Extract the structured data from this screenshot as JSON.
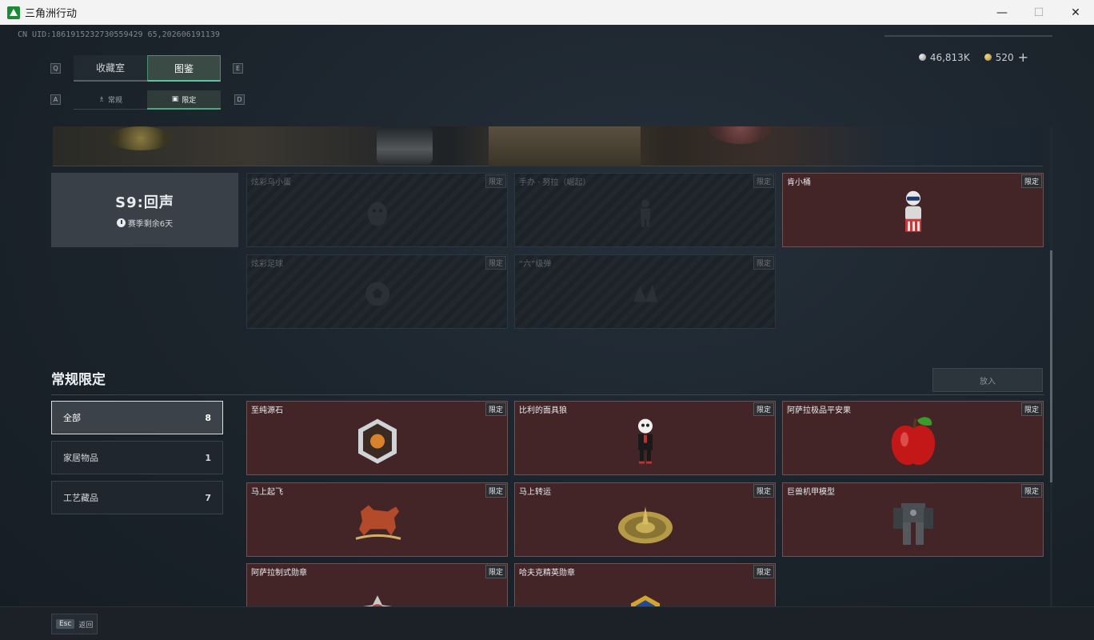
{
  "window": {
    "title": "三角洲行动",
    "minimize": "—",
    "maximize": "☐",
    "close": "✕"
  },
  "uid": "CN UID:1861915232730559429 65,202606191139",
  "currency": {
    "silver": "46,813K",
    "gold": "520",
    "add": "+"
  },
  "tabs": {
    "left_key": "Q",
    "right_key": "E",
    "collection": "收藏室",
    "catalog": "图鉴"
  },
  "subtabs": {
    "left_key": "A",
    "right_key": "D",
    "regular": "常规",
    "limited": "限定"
  },
  "season": {
    "title": "S9:回声",
    "remaining": "赛季剩余6天"
  },
  "season_items": [
    {
      "name": "炫彩乌小蛋",
      "tag": "限定",
      "owned": false
    },
    {
      "name": "手办 · 努拉（崛起）",
      "tag": "限定",
      "owned": false
    },
    {
      "name": "肯小桶",
      "tag": "限定",
      "owned": true
    },
    {
      "name": "炫彩足球",
      "tag": "限定",
      "owned": false
    },
    {
      "name": "“六”级弹",
      "tag": "限定",
      "owned": false
    }
  ],
  "section": {
    "title": "常规限定",
    "import_label": "放入"
  },
  "filters": [
    {
      "label": "全部",
      "count": "8"
    },
    {
      "label": "家居物品",
      "count": "1"
    },
    {
      "label": "工艺藏品",
      "count": "7"
    }
  ],
  "regular_items": [
    {
      "name": "至纯源石",
      "tag": "限定"
    },
    {
      "name": "比利的面具狼",
      "tag": "限定"
    },
    {
      "name": "阿萨拉极品平安果",
      "tag": "限定"
    },
    {
      "name": "马上起飞",
      "tag": "限定"
    },
    {
      "name": "马上转运",
      "tag": "限定"
    },
    {
      "name": "巨兽机甲模型",
      "tag": "限定"
    },
    {
      "name": "阿萨拉制式勋章",
      "tag": "限定"
    },
    {
      "name": "哈夫克精英勋章",
      "tag": "限定"
    }
  ],
  "footer": {
    "esc": "Esc",
    "back": "返回"
  },
  "colors": {
    "accent": "#5fc29a",
    "owned_card": "#432527",
    "background": "#1a2128"
  }
}
